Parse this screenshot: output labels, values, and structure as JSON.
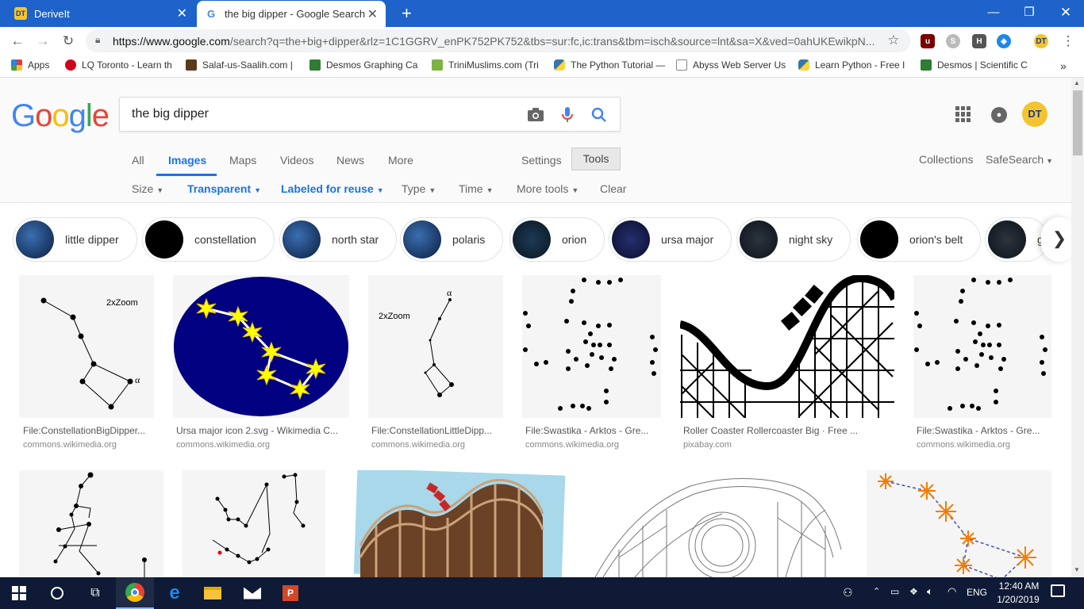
{
  "browser": {
    "tabs": [
      {
        "label": "DeriveIt",
        "favicon": "DT"
      },
      {
        "label": "the big dipper - Google Search",
        "favicon": "G"
      }
    ],
    "new_tab": "+",
    "url_host": "https://www.google.com",
    "url_rest": "/search?q=the+big+dipper&rlz=1C1GGRV_enPK752PK752&tbs=sur:fc,ic:trans&tbm=isch&source=lnt&sa=X&ved=0ahUKEwikpN...",
    "profile_initials": "DT",
    "extensions": [
      "uBlock",
      "skype",
      "H",
      "edge-sync"
    ]
  },
  "bookmarks": [
    {
      "label": "Apps",
      "icon": "apps-grid-icon"
    },
    {
      "label": "LQ Toronto - Learn th",
      "icon": "lq-icon",
      "color": "#d0021b"
    },
    {
      "label": "Salaf-us-Saalih.com |",
      "icon": "salaf-icon",
      "color": "#5a3a1a"
    },
    {
      "label": "Desmos Graphing Ca",
      "icon": "desmos-icon",
      "color": "#2e7d32"
    },
    {
      "label": "TriniMuslims.com (Tri",
      "icon": "flag-icon",
      "color": "#7cb342"
    },
    {
      "label": "The Python Tutorial —",
      "icon": "python-icon",
      "color": "#3776ab"
    },
    {
      "label": "Abyss Web Server Us",
      "icon": "page-icon",
      "color": "#888888"
    },
    {
      "label": "Learn Python - Free I",
      "icon": "python-icon",
      "color": "#3776ab"
    },
    {
      "label": "Desmos | Scientific C",
      "icon": "desmos-icon",
      "color": "#2e7d32"
    }
  ],
  "bookmarks_more": "»",
  "google": {
    "logo": "Google",
    "query": "the big dipper",
    "nav": [
      "All",
      "Images",
      "Maps",
      "Videos",
      "News",
      "More"
    ],
    "settings": "Settings",
    "tools": "Tools",
    "collections": "Collections",
    "safesearch": "SafeSearch",
    "filters": [
      "Size",
      "Transparent",
      "Labeled for reuse",
      "Type",
      "Time",
      "More tools",
      "Clear"
    ]
  },
  "chips": [
    "little dipper",
    "constellation",
    "north star",
    "polaris",
    "orion",
    "ursa major",
    "night sky",
    "orion's belt",
    "g"
  ],
  "results_row1": [
    {
      "title": "File:ConstellationBigDipper...",
      "source": "commons.wikimedia.org",
      "label": "2xZoom",
      "alpha": "α"
    },
    {
      "title": "Ursa major icon 2.svg - Wikimedia C...",
      "source": "commons.wikimedia.org"
    },
    {
      "title": "File:ConstellationLittleDipp...",
      "source": "commons.wikimedia.org",
      "label": "2xZoom",
      "alpha": "α"
    },
    {
      "title": "File:Swastika - Arktos - Gre...",
      "source": "commons.wikimedia.org"
    },
    {
      "title": "Roller Coaster Rollercoaster Big · Free ...",
      "source": "pixabay.com"
    },
    {
      "title": "File:Swastika - Arktos - Gre...",
      "source": "commons.wikimedia.org"
    }
  ],
  "taskbar": {
    "time": "12:40 AM",
    "date": "1/20/2019",
    "lang": "ENG"
  },
  "colors": {
    "google_blue": "#1a73e8",
    "tab_strip": "#1d63c9",
    "taskbar": "#0e1a36"
  }
}
